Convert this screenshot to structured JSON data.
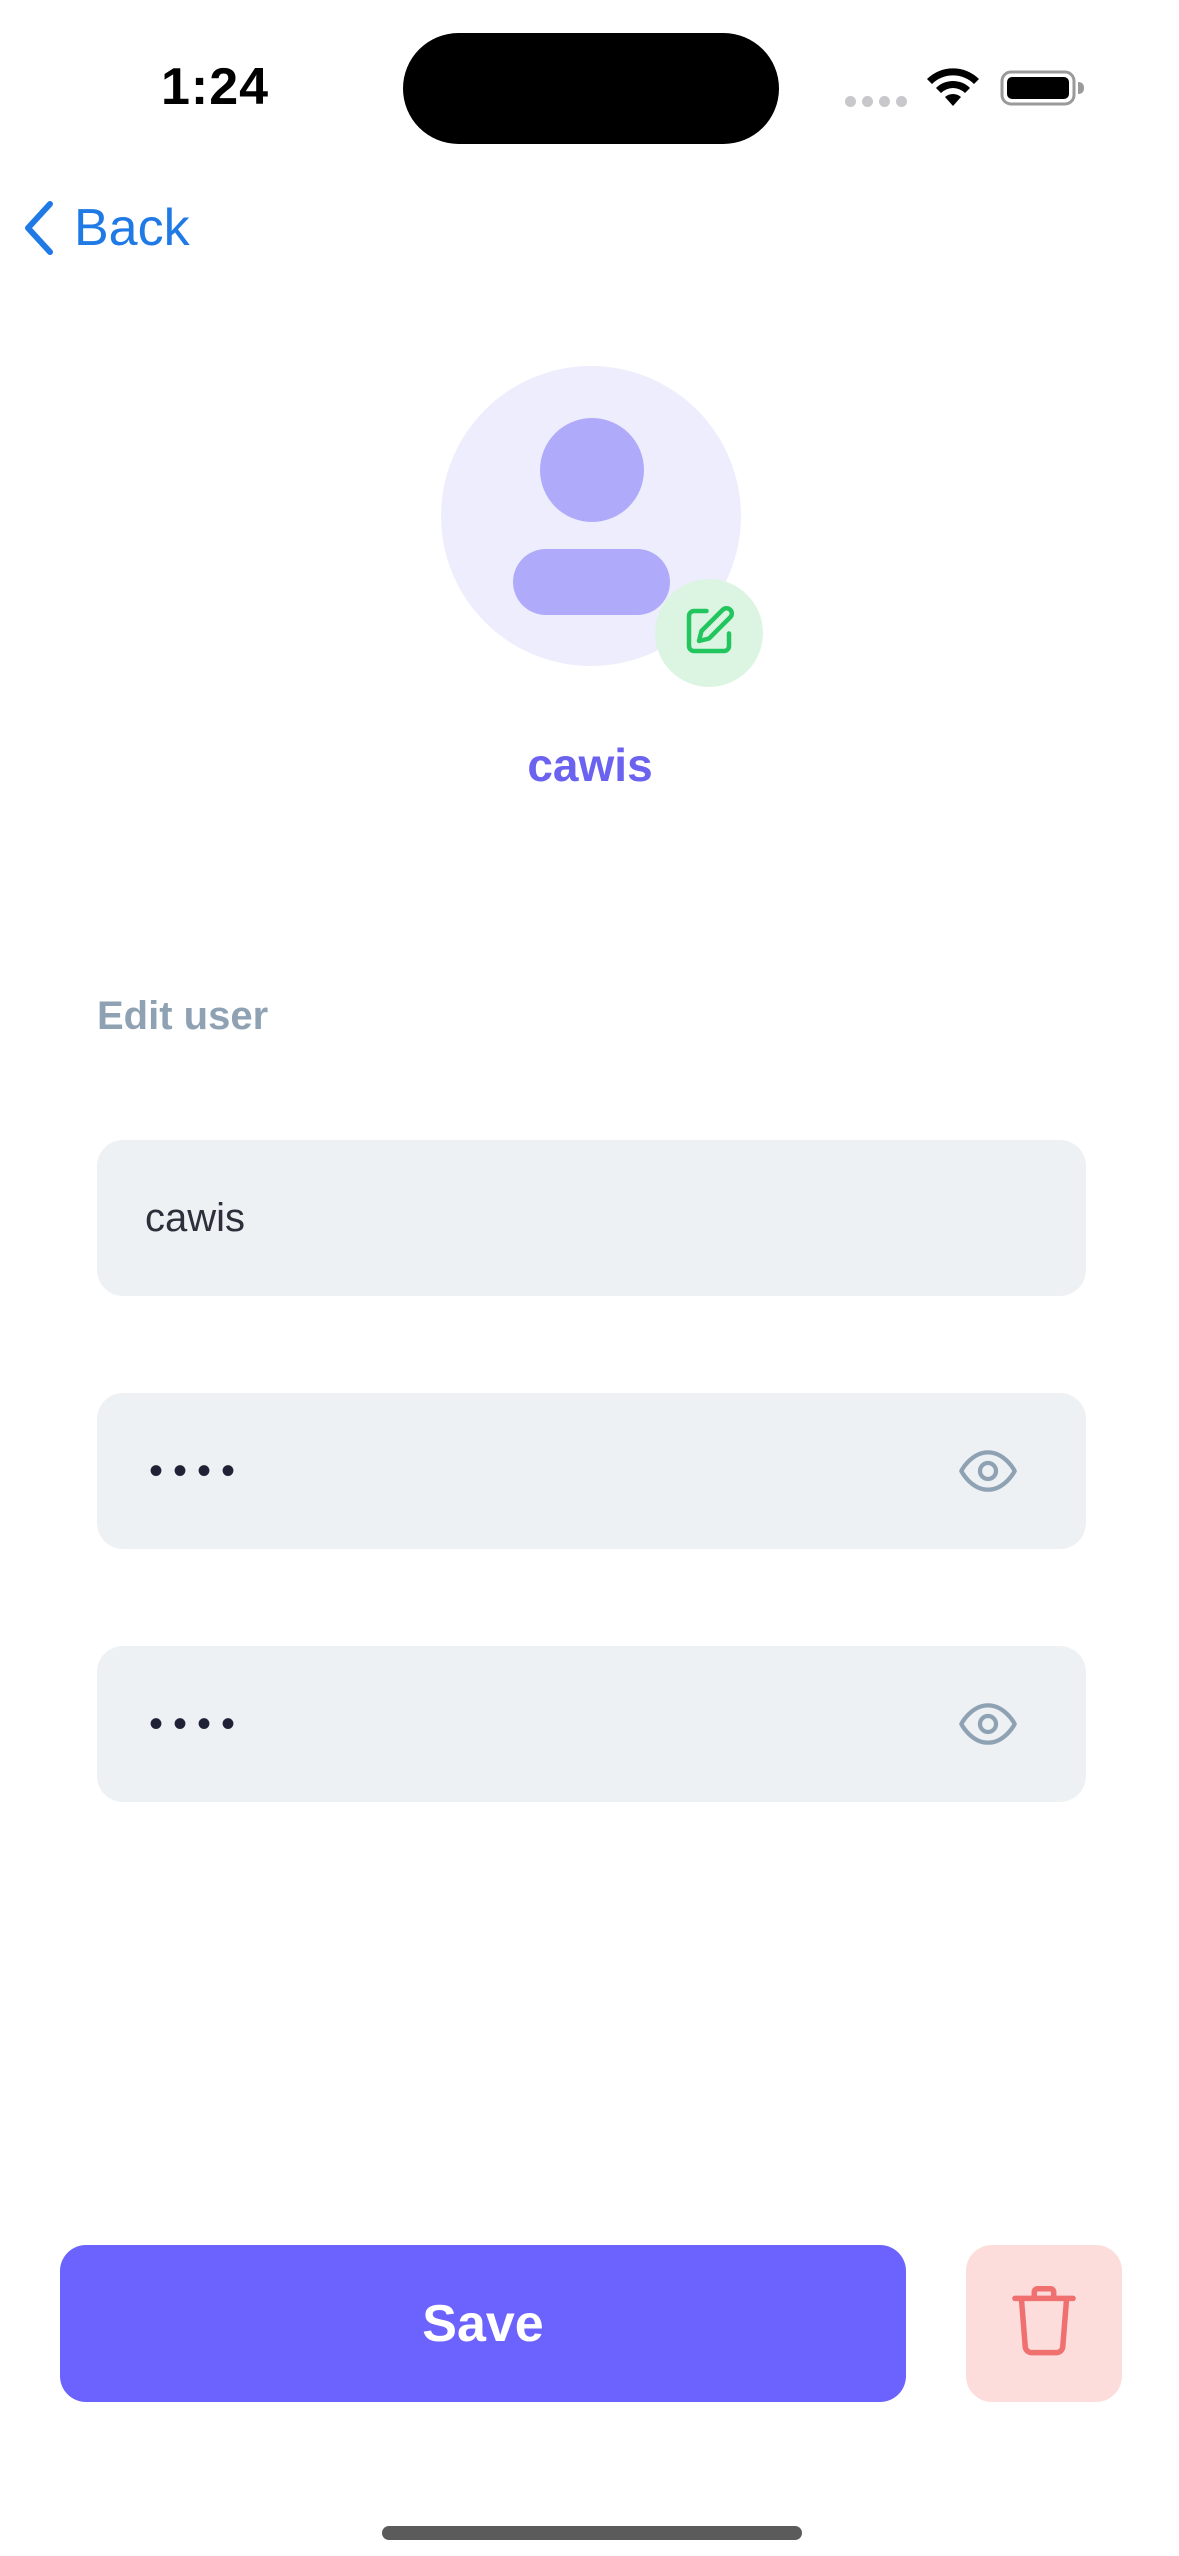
{
  "status_bar": {
    "time": "1:24"
  },
  "nav": {
    "back_label": "Back",
    "back_icon": "chevron-left-icon"
  },
  "profile": {
    "username": "cawis",
    "avatar_icon": "user-icon",
    "edit_icon": "pencil-square-icon"
  },
  "form": {
    "section_label": "Edit user",
    "username_value": "cawis",
    "password_value": "••••",
    "confirm_password_value": "••••",
    "visibility_icon": "eye-icon"
  },
  "actions": {
    "save_label": "Save",
    "delete_icon": "trash-icon"
  },
  "colors": {
    "accent": "#6c63ff",
    "back_link": "#1f7ae6",
    "delete_bg": "#fddcdc",
    "delete_icon": "#f07070",
    "edit_bg": "#dcf5e2",
    "edit_icon": "#22c55e",
    "field_bg": "#eef1f4"
  }
}
